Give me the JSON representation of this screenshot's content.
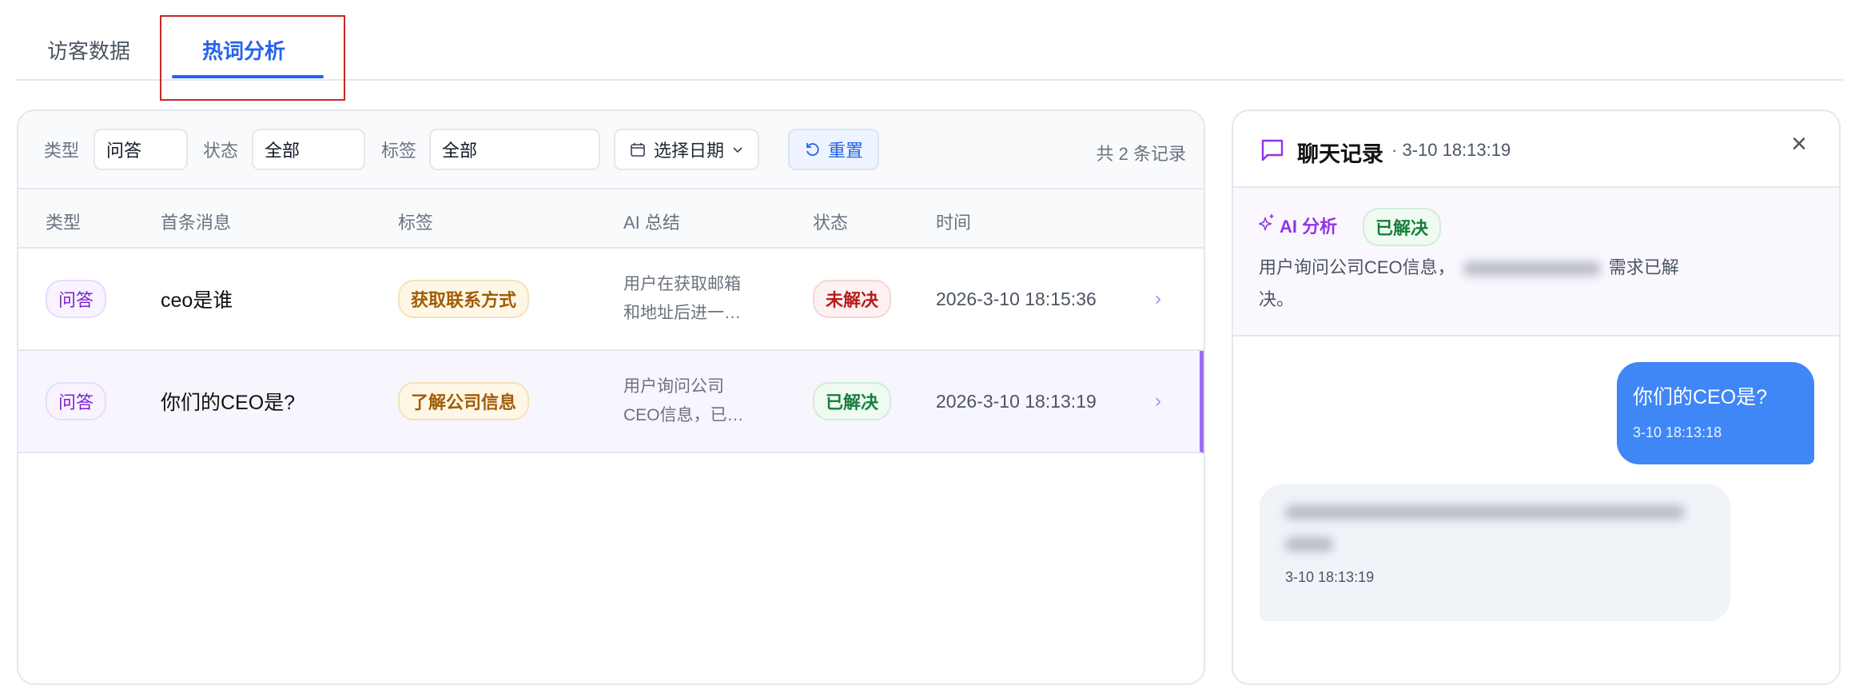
{
  "tabs": [
    {
      "label": "访客数据",
      "active": false
    },
    {
      "label": "热词分析",
      "active": true
    }
  ],
  "filters": {
    "type_label": "类型",
    "type_value": "问答",
    "status_label": "状态",
    "status_value": "全部",
    "tag_label": "标签",
    "tag_value": "全部",
    "date_placeholder": "选择日期",
    "reset_label": "重置",
    "count_text": "共 2 条记录"
  },
  "table": {
    "headers": [
      "类型",
      "首条消息",
      "标签",
      "AI 总结",
      "状态",
      "时间"
    ],
    "rows": [
      {
        "type": "问答",
        "message": "ceo是谁",
        "tag": "获取联系方式",
        "ai_line1": "用户在获取邮箱",
        "ai_line2": "和地址后进一…",
        "status": "未解决",
        "time": "2026-3-10 18:15:36"
      },
      {
        "type": "问答",
        "message": "你们的CEO是?",
        "tag": "了解公司信息",
        "ai_line1": "用户询问公司",
        "ai_line2": "CEO信息，已…",
        "status": "已解决",
        "time": "2026-3-10 18:13:19"
      }
    ]
  },
  "chat": {
    "title": "聊天记录",
    "subtitle": "· 3-10 18:13:19",
    "ai_label": "AI 分析",
    "ai_status": "已解决",
    "summary_start": "用户询问公司CEO信息，",
    "summary_end": "需求已解",
    "summary_tail": "决。",
    "user_message": "你们的CEO是?",
    "user_time": "3-10 18:13:18",
    "bot_time": "3-10 18:13:19"
  },
  "colors": {
    "accent": "#2563eb",
    "user_bubble": "#3f86f7",
    "purple": "#9b6cf0"
  }
}
